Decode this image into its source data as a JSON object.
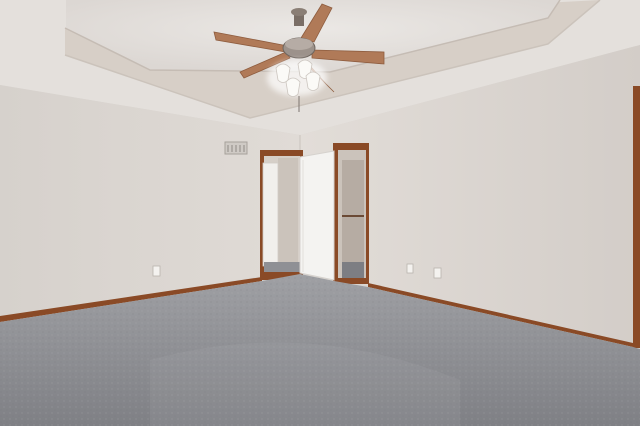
{
  "scene": {
    "subject": "empty-bedroom-interior",
    "elements": [
      "tray-ceiling",
      "ceiling-fan",
      "air-vent",
      "interior-doorway",
      "open-door",
      "walk-in-closet",
      "wall-outlets",
      "baseboards",
      "carpet-floor",
      "right-door-frame"
    ],
    "colors": {
      "wall": "#dcd7d2",
      "wall_shadow": "#cfc9c4",
      "ceiling": "#e6e2de",
      "tray_band": "#d9d1ca",
      "trim_wood": "#8a4a26",
      "door_white": "#f4f3f1",
      "carpet": "#8e8f93",
      "fan_blade": "#b07a58"
    }
  }
}
